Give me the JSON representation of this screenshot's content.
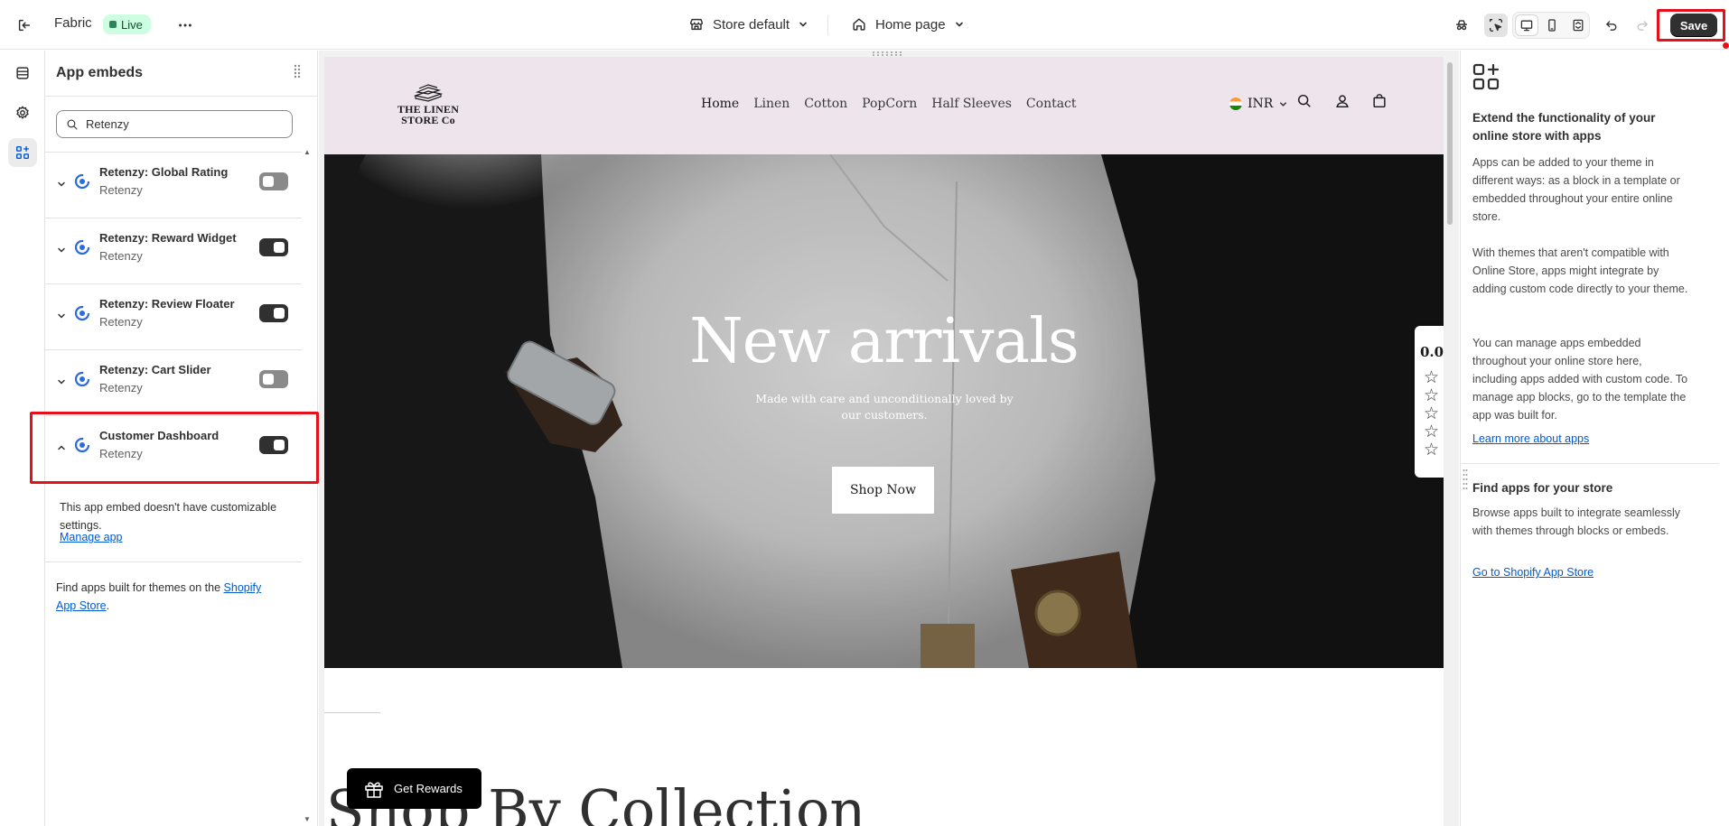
{
  "topbar": {
    "theme_name": "Fabric",
    "status_badge": "Live",
    "store_selector": "Store default",
    "page_selector": "Home page",
    "save_label": "Save"
  },
  "sidebar": {
    "title": "App embeds",
    "search_value": "Retenzy",
    "embeds": [
      {
        "name": "Retenzy: Global Rating",
        "vendor": "Retenzy",
        "enabled": false
      },
      {
        "name": "Retenzy: Reward Widget",
        "vendor": "Retenzy",
        "enabled": true
      },
      {
        "name": "Retenzy: Review Floater",
        "vendor": "Retenzy",
        "enabled": true
      },
      {
        "name": "Retenzy: Cart Slider",
        "vendor": "Retenzy",
        "enabled": false
      },
      {
        "name": "Customer Dashboard",
        "vendor": "Retenzy",
        "enabled": true,
        "expanded": true
      }
    ],
    "expanded_text": "This app embed doesn't have customizable settings.",
    "manage_app_link": "Manage app",
    "footer_prefix": "Find apps built for themes on the ",
    "footer_link": "Shopify App Store",
    "footer_suffix": "."
  },
  "preview": {
    "logo_text": "THE LINEN\nSTORE Co",
    "nav": [
      "Home",
      "Linen",
      "Cotton",
      "PopCorn",
      "Half Sleeves",
      "Contact"
    ],
    "currency": "INR",
    "hero_title": "New arrivals",
    "hero_subtitle": "Made with care and unconditionally loved by our customers.",
    "hero_button": "Shop Now",
    "rating_value": "0.0",
    "rating_stars": 5,
    "collection_title": "Shop By Collection",
    "rewards_button": "Get Rewards"
  },
  "right_panel": {
    "heading": "Extend the functionality of your online store with apps",
    "p1": "Apps can be added to your theme in different ways: as a block in a template or embedded throughout your entire online store.",
    "p2": "With themes that aren't compatible with Online Store, apps might integrate by adding custom code directly to your theme.",
    "p3": "You can manage apps embedded throughout your online store here, including apps added with custom code. To manage app blocks, go to the template the app was built for.",
    "learn_more": "Learn more about apps",
    "find_heading": "Find apps for your store",
    "find_text": "Browse apps built to integrate seamlessly with themes through blocks or embeds.",
    "app_store_link": "Go to Shopify App Store"
  },
  "colors": {
    "accent_highlight": "#e3121a",
    "link": "#005bd3",
    "live_badge_bg": "#cdfee1",
    "store_header_bg": "#ede4ec",
    "toggle_on": "#303030",
    "toggle_off": "#8a8a8a"
  }
}
